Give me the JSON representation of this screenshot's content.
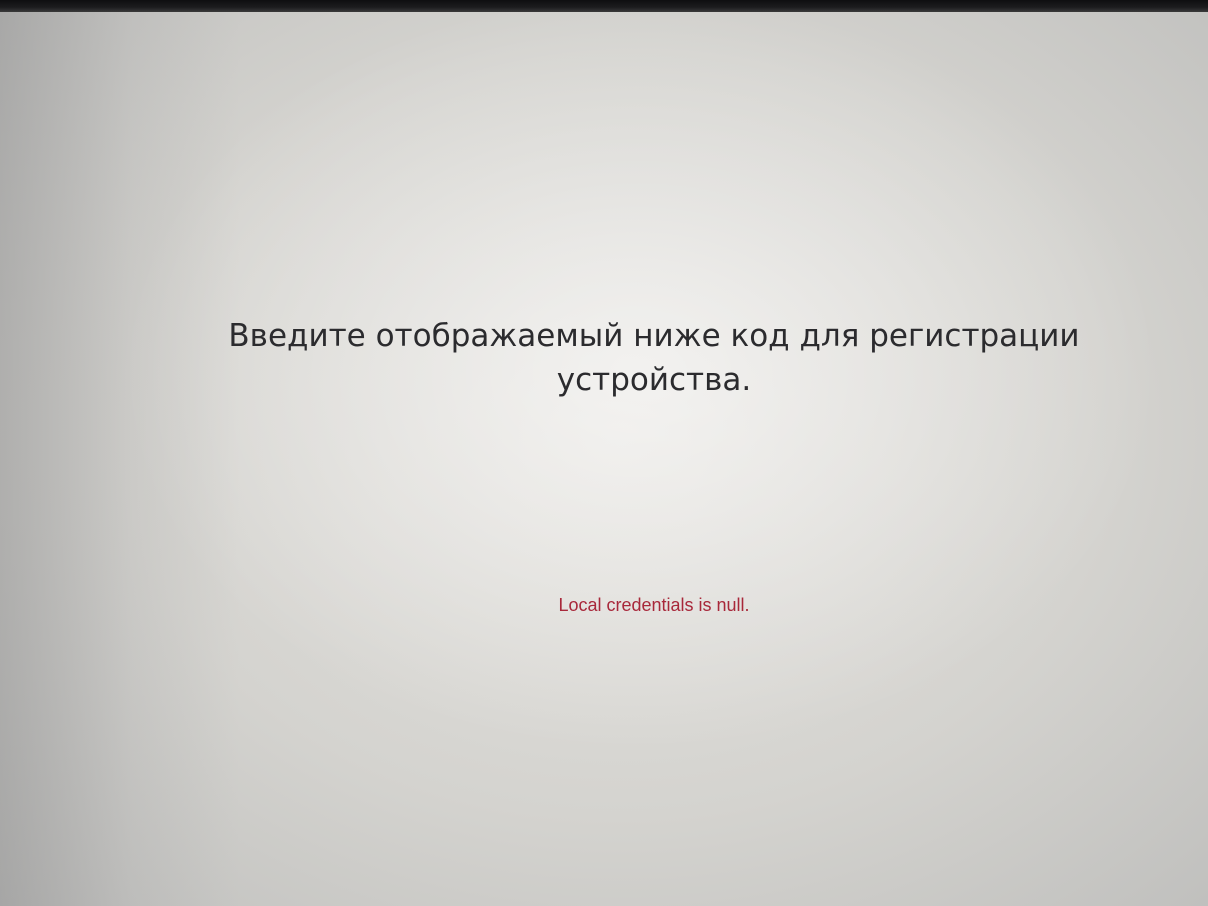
{
  "registration": {
    "prompt": "Введите отображаемый ниже код для регистрации устройства.",
    "error_message": "Local credentials is null."
  },
  "colors": {
    "prompt_text": "#2b2b2e",
    "error_text": "#a8283a",
    "background": "#e2e1dd"
  }
}
